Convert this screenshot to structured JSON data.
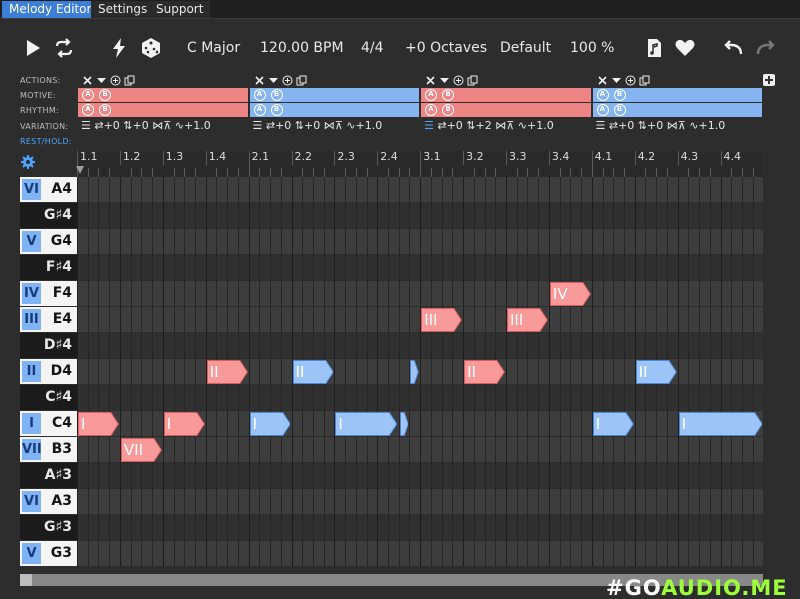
{
  "tabs": [
    {
      "label": "Melody Editor",
      "active": true
    },
    {
      "label": "Settings",
      "active": false
    },
    {
      "label": "Support",
      "active": false
    }
  ],
  "toolbar": {
    "key": "C Major",
    "tempo": "120.00 BPM",
    "meter": "4/4",
    "octaves": "+0 Octaves",
    "preset": "Default",
    "zoom": "100 %"
  },
  "row_labels": {
    "actions": "ACTIONS:",
    "motive": "MOTIVE:",
    "rhythm": "RHYTHM:",
    "variation": "VARIATION:",
    "rest_hold": "REST/HOLD:"
  },
  "sections": [
    {
      "motive": "red",
      "rhythm": "red",
      "variation": [
        "+0",
        "+0",
        "+1.0"
      ]
    },
    {
      "motive": "blue",
      "rhythm": "blue",
      "variation": [
        "+0",
        "+0",
        "+1.0"
      ]
    },
    {
      "motive": "red",
      "rhythm": "red",
      "variation": [
        "+0",
        "+2",
        "+1.0"
      ]
    },
    {
      "motive": "blue",
      "rhythm": "blue",
      "variation": [
        "+0",
        "+0",
        "+1.0"
      ]
    }
  ],
  "ab_labels": [
    "A",
    "B"
  ],
  "ruler": [
    "1.1",
    "1.2",
    "1.3",
    "1.4",
    "2.1",
    "2.2",
    "2.3",
    "2.4",
    "3.1",
    "3.2",
    "3.3",
    "3.4",
    "4.1",
    "4.2",
    "4.3",
    "4.4"
  ],
  "keys": [
    {
      "note": "A4",
      "degree": "VI",
      "color": "white"
    },
    {
      "note": "G♯4",
      "degree": "",
      "color": "black"
    },
    {
      "note": "G4",
      "degree": "V",
      "color": "white"
    },
    {
      "note": "F♯4",
      "degree": "",
      "color": "black"
    },
    {
      "note": "F4",
      "degree": "IV",
      "color": "white"
    },
    {
      "note": "E4",
      "degree": "III",
      "color": "white"
    },
    {
      "note": "D♯4",
      "degree": "",
      "color": "black"
    },
    {
      "note": "D4",
      "degree": "II",
      "color": "white"
    },
    {
      "note": "C♯4",
      "degree": "",
      "color": "black"
    },
    {
      "note": "C4",
      "degree": "I",
      "color": "white"
    },
    {
      "note": "B3",
      "degree": "VII",
      "color": "white"
    },
    {
      "note": "A♯3",
      "degree": "",
      "color": "black"
    },
    {
      "note": "A3",
      "degree": "VI",
      "color": "white"
    },
    {
      "note": "G♯3",
      "degree": "",
      "color": "black"
    },
    {
      "note": "G3",
      "degree": "V",
      "color": "white"
    }
  ],
  "notes": [
    {
      "label": "I",
      "row": 9,
      "start": 0,
      "len": 1,
      "color": "red"
    },
    {
      "label": "VII",
      "row": 10,
      "start": 1,
      "len": 1,
      "color": "red"
    },
    {
      "label": "I",
      "row": 9,
      "start": 2,
      "len": 1,
      "color": "red"
    },
    {
      "label": "II",
      "row": 7,
      "start": 3,
      "len": 1,
      "color": "red"
    },
    {
      "label": "I",
      "row": 9,
      "start": 4,
      "len": 1,
      "color": "blue"
    },
    {
      "label": "II",
      "row": 7,
      "start": 5,
      "len": 1,
      "color": "blue"
    },
    {
      "label": "I",
      "row": 9,
      "start": 6,
      "len": 1.5,
      "color": "blue"
    },
    {
      "label": "",
      "row": 9,
      "start": 7.5,
      "len": 0.25,
      "color": "blue"
    },
    {
      "label": "",
      "row": 7,
      "start": 7.75,
      "len": 0.25,
      "color": "blue"
    },
    {
      "label": "III",
      "row": 5,
      "start": 8,
      "len": 1,
      "color": "red"
    },
    {
      "label": "II",
      "row": 7,
      "start": 9,
      "len": 1,
      "color": "red"
    },
    {
      "label": "III",
      "row": 5,
      "start": 10,
      "len": 1,
      "color": "red"
    },
    {
      "label": "IV",
      "row": 4,
      "start": 11,
      "len": 1,
      "color": "red"
    },
    {
      "label": "I",
      "row": 9,
      "start": 12,
      "len": 1,
      "color": "blue"
    },
    {
      "label": "II",
      "row": 7,
      "start": 13,
      "len": 1,
      "color": "blue"
    },
    {
      "label": "I",
      "row": 9,
      "start": 14,
      "len": 2,
      "color": "blue"
    }
  ],
  "colors": {
    "red_fill": "#f99a9a",
    "red_stroke": "#d85c5c",
    "blue_fill": "#9cc4f7",
    "blue_stroke": "#4a86d8",
    "accent": "#3d7fd6"
  },
  "brand": {
    "prefix": "#GO",
    "suffix": "AUDIO.ME"
  }
}
